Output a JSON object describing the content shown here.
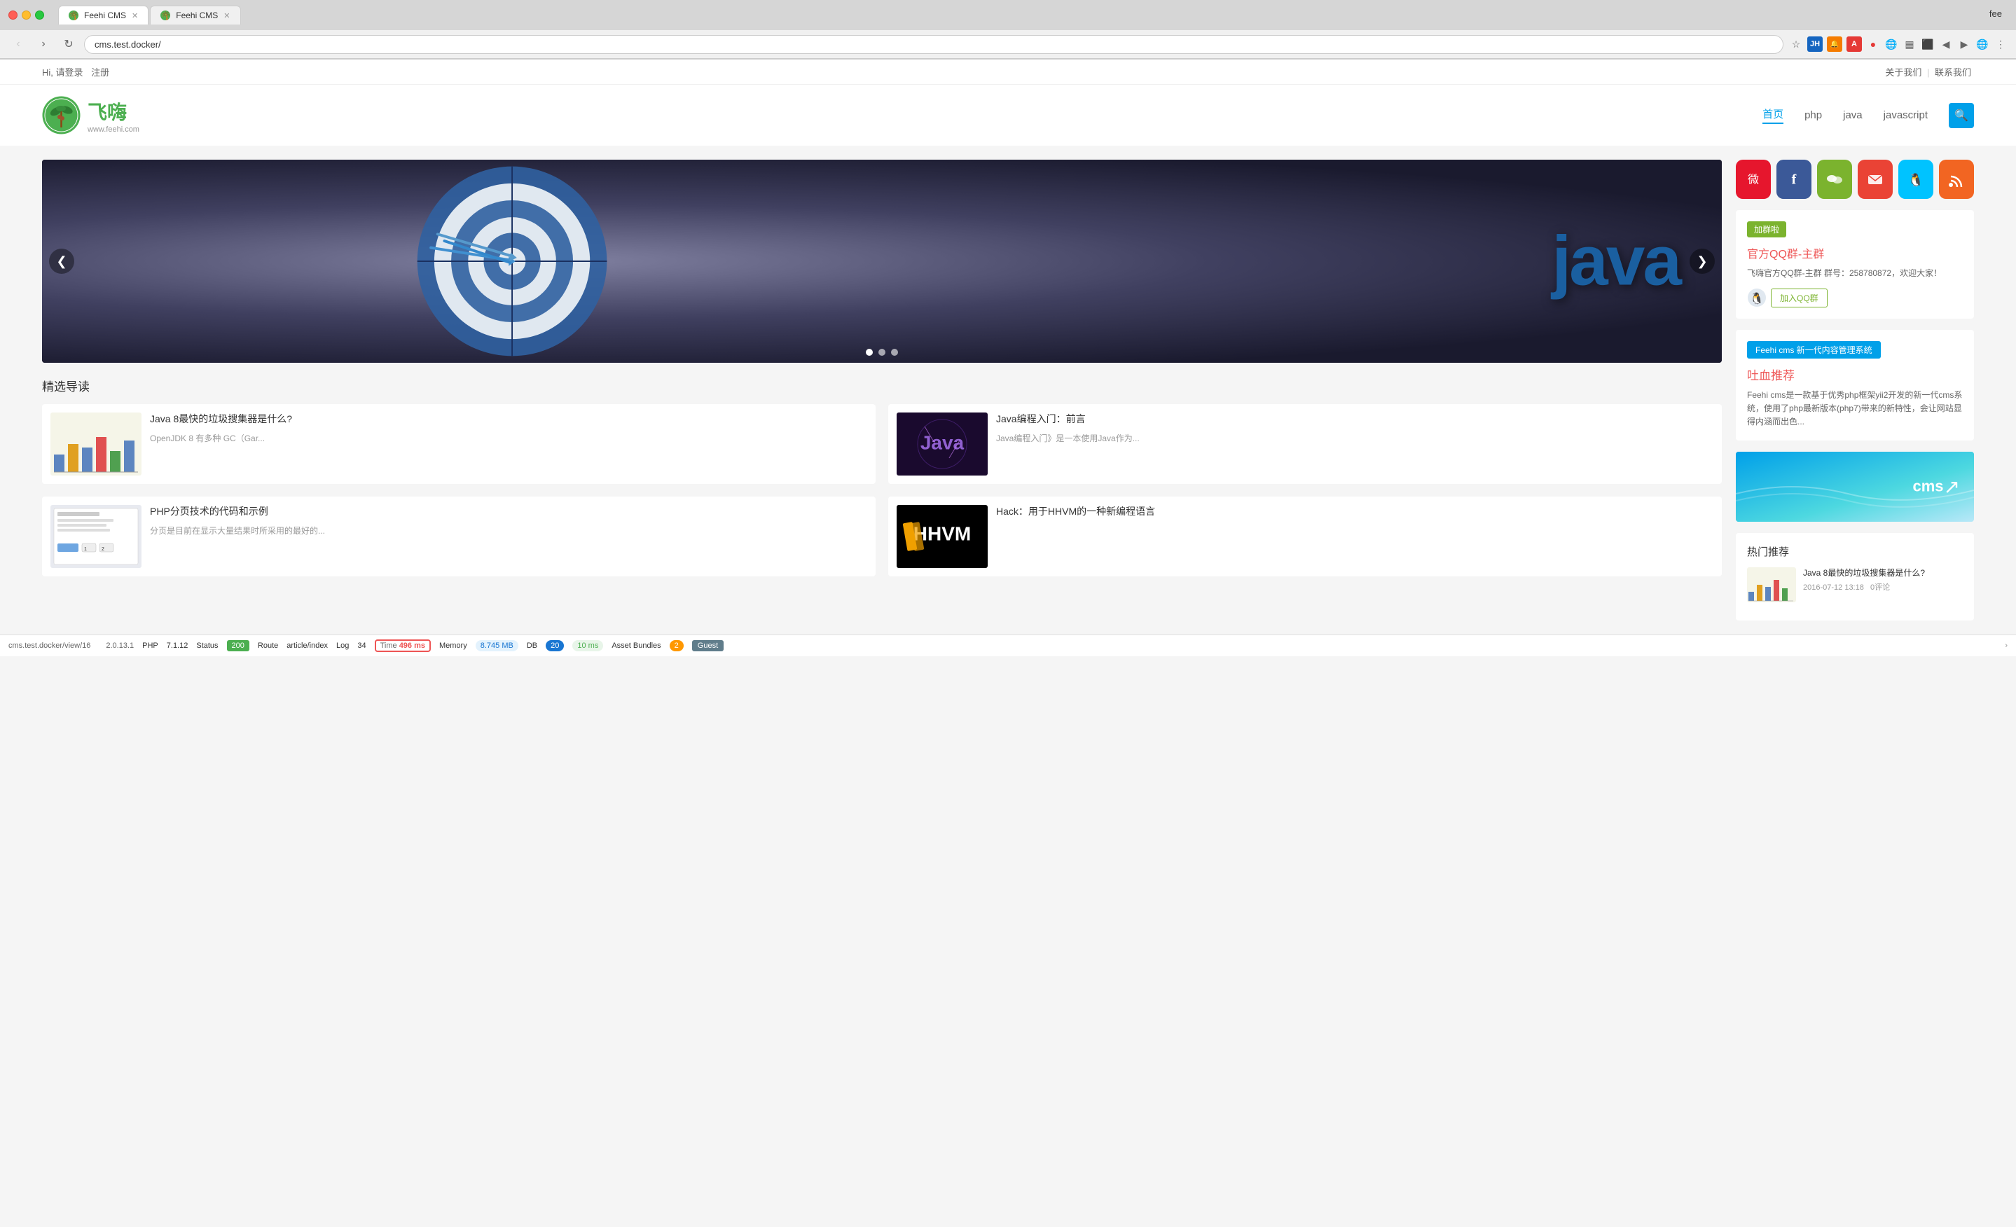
{
  "browser": {
    "fee_label": "fee",
    "tab1": {
      "label": "Feehi CMS",
      "favicon": "🌴"
    },
    "tab2": {
      "label": "Feehi CMS",
      "favicon": "🌴"
    },
    "address": "cms.test.docker/",
    "back_btn": "‹",
    "forward_btn": "›",
    "reload_btn": "↻",
    "status_url": "cms.test.docker/view/16"
  },
  "topbar": {
    "hi_text": "Hi, 请登录",
    "register": "注册",
    "about": "关于我们",
    "contact": "联系我们"
  },
  "header": {
    "logo_url": "www.feehi.com",
    "nav": {
      "home": "首页",
      "php": "php",
      "java": "java",
      "javascript": "javascript"
    }
  },
  "carousel": {
    "java_text": "java",
    "dots": [
      true,
      false,
      false
    ],
    "prev": "❮",
    "next": "❯"
  },
  "featured": {
    "title": "精选导读",
    "articles": [
      {
        "title": "Java 8最快的垃圾搜集器是什么?",
        "desc": "OpenJDK 8 有多种 GC（Gar...",
        "thumb_type": "java-gc"
      },
      {
        "title": "Java编程入门：前言",
        "desc": "Java编程入门》是一本使用Java作为...",
        "thumb_type": "java-intro"
      },
      {
        "title": "PHP分页技术的代码和示例",
        "desc": "分页是目前在显示大量结果时所采用的最好的...",
        "thumb_type": "php-page"
      },
      {
        "title": "Hack：用于HHVM的一种新编程语言",
        "desc": "",
        "thumb_type": "hhvm"
      }
    ]
  },
  "sidebar": {
    "social": [
      {
        "name": "weibo",
        "icon": "微",
        "class": "social-weibo"
      },
      {
        "name": "facebook",
        "icon": "f",
        "class": "social-facebook"
      },
      {
        "name": "wechat",
        "icon": "💬",
        "class": "social-wechat"
      },
      {
        "name": "email",
        "icon": "✉",
        "class": "social-email"
      },
      {
        "name": "qq",
        "icon": "🐧",
        "class": "social-qq"
      },
      {
        "name": "rss",
        "icon": "▶",
        "class": "social-rss"
      }
    ],
    "qq_group": {
      "badge": "加群啦",
      "title": "官方QQ群-主群",
      "desc": "飞嗨官方QQ群-主群 群号：258780872，欢迎大家！",
      "join_btn": "加入QQ群"
    },
    "feehi_card": {
      "badge": "Feehi cms 新一代内容管理系统",
      "title": "吐血推荐",
      "desc": "Feehi cms是一款基于优秀php框架yii2开发的新一代cms系统，使用了php最新版本(php7)带来的新特性，会让网站显得内涵而出色..."
    },
    "hot": {
      "title": "热门推荐",
      "items": [
        {
          "title": "Java 8最快的垃圾搜集器是什么?",
          "date": "2016-07-12 13:18",
          "comment": "0评论"
        }
      ]
    }
  },
  "statusbar": {
    "url": "cms.test.docker/view/16",
    "version": "2.0.13.1",
    "php": "PHP",
    "php_ver": "7.1.12",
    "status_label": "Status",
    "status_code": "200",
    "route_label": "Route",
    "route_val": "article/index",
    "log_label": "Log",
    "log_count": "34",
    "time_label": "Time",
    "time_val": "496 ms",
    "memory_label": "Memory",
    "memory_val": "8.745 MB",
    "db_label": "DB",
    "db_count": "20",
    "db_time": "10 ms",
    "bundles_label": "Asset Bundles",
    "bundles_count": "2",
    "guest_label": "Guest",
    "arrow": "›"
  }
}
